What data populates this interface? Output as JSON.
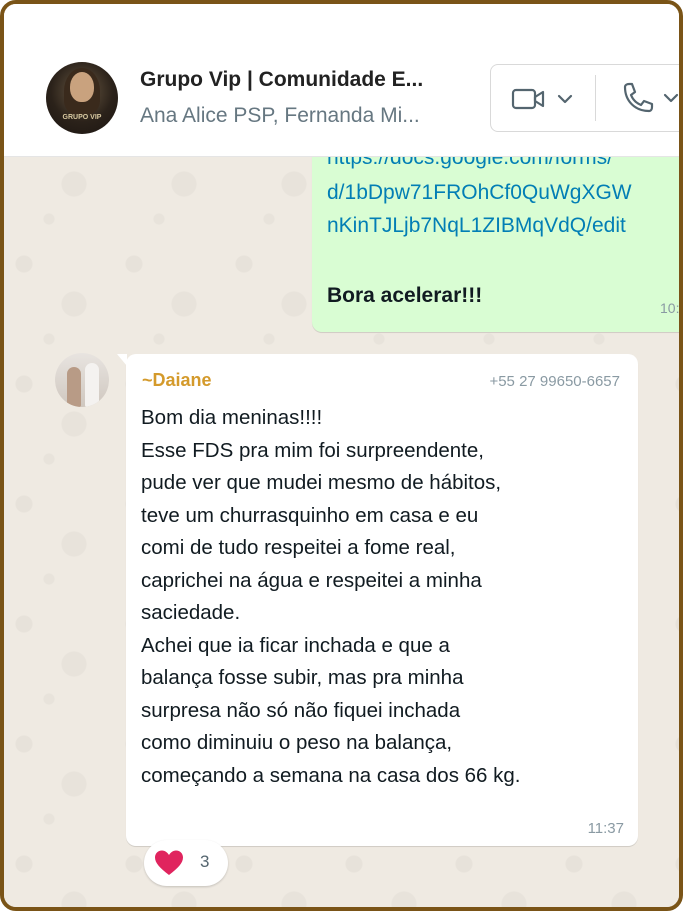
{
  "header": {
    "title": "Grupo Vip | Comunidade E...",
    "participants": "Ana Alice PSP, Fernanda Mi...",
    "avatar_tag": "GRUPO VIP",
    "video_call_icon": "video-camera-icon",
    "voice_call_icon": "phone-icon",
    "dropdown_icon": "chevron-down-icon"
  },
  "outgoing_message": {
    "link_lines": [
      "https://docs.google.com/forms/",
      "d/1bDpw71FROhCf0QuWgXGW",
      "nKinTJLjb7NqL1ZIBMqVdQ/edit"
    ],
    "text": "Bora acelerar!!!",
    "time": "10:"
  },
  "incoming_message": {
    "sender_name": "~Daiane",
    "sender_phone": "+55 27 99650-6657",
    "lines": [
      "Bom dia meninas!!!!",
      "Esse FDS pra mim foi surpreendente,",
      "pude ver que mudei mesmo de hábitos,",
      "teve um churrasquinho em casa e eu",
      "comi de tudo  respeitei a fome real,",
      "caprichei na água e respeitei a minha",
      "saciedade.",
      "Achei que ia ficar inchada e que a",
      "balança fosse subir, mas pra minha",
      "surpresa não só não fiquei inchada",
      "como diminuiu o peso na balança,",
      "começando a semana na casa dos 66 kg."
    ],
    "time": "11:37",
    "reaction": {
      "emoji_icon": "heart-icon",
      "count": "3"
    }
  },
  "colors": {
    "frame": "#7a5417",
    "outgoing_bubble": "#d9fdd3",
    "incoming_bubble": "#ffffff",
    "link": "#027eb5",
    "sender_name": "#d49a2b",
    "heart": "#e0245e"
  }
}
